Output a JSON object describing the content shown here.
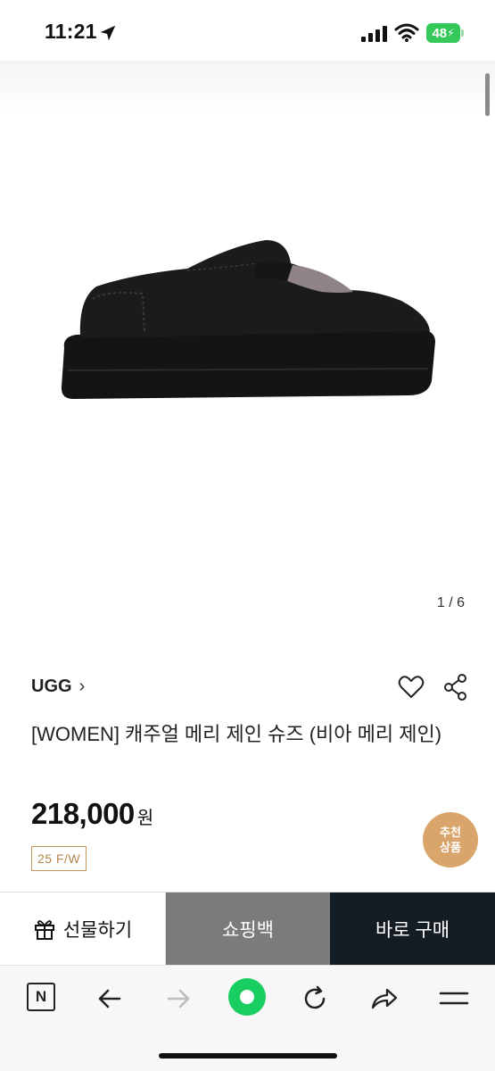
{
  "status_bar": {
    "time": "11:21",
    "battery": "48"
  },
  "gallery": {
    "counter": "1 / 6"
  },
  "product": {
    "brand": "UGG",
    "brand_chevron": "›",
    "title": "[WOMEN] 캐주얼 메리 제인 슈즈 (비아 메리 제인)",
    "price": "218,000",
    "price_unit": "원",
    "season": "25 F/W"
  },
  "recommend": {
    "line1": "추천",
    "line2": "상품"
  },
  "buy_bar": {
    "gift_label": "선물하기",
    "bag_label": "쇼핑백",
    "buy_label": "바로 구매"
  },
  "toolbar": {
    "naver_letter": "N"
  },
  "colors": {
    "accent_green": "#19ce60",
    "buy_button": "#141c24",
    "bag_button": "#7b7b7b",
    "recommend": "#d9a56b",
    "season_badge": "#c49563"
  },
  "icons": [
    "location-arrow-icon",
    "signal-icon",
    "wifi-icon",
    "heart-icon",
    "share-icon",
    "gift-icon",
    "back-arrow-icon",
    "forward-arrow-icon",
    "reload-icon",
    "share-arrow-icon",
    "menu-icon"
  ]
}
